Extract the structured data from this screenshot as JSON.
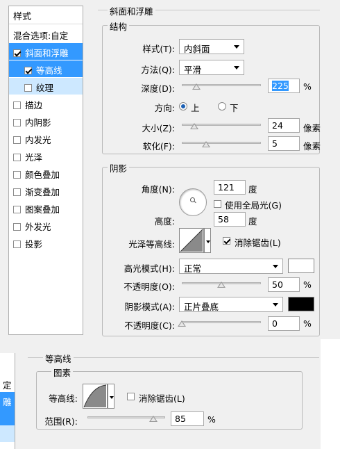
{
  "left_panel": {
    "header": "样式",
    "items": [
      {
        "label": "混合选项:自定",
        "checkbox": false
      },
      {
        "label": "斜面和浮雕",
        "checkbox": true,
        "checked": true,
        "selected": true
      },
      {
        "label": "等高线",
        "checkbox": true,
        "checked": true,
        "sub": true,
        "selected": true
      },
      {
        "label": "纹理",
        "checkbox": true,
        "checked": false,
        "sub": true
      },
      {
        "label": "描边",
        "checkbox": true,
        "checked": false
      },
      {
        "label": "内阴影",
        "checkbox": true,
        "checked": false
      },
      {
        "label": "内发光",
        "checkbox": true,
        "checked": false
      },
      {
        "label": "光泽",
        "checkbox": true,
        "checked": false
      },
      {
        "label": "颜色叠加",
        "checkbox": true,
        "checked": false
      },
      {
        "label": "渐变叠加",
        "checkbox": true,
        "checked": false
      },
      {
        "label": "图案叠加",
        "checkbox": true,
        "checked": false
      },
      {
        "label": "外发光",
        "checkbox": true,
        "checked": false
      },
      {
        "label": "投影",
        "checkbox": true,
        "checked": false
      }
    ]
  },
  "bevel": {
    "title": "斜面和浮雕",
    "structure": {
      "legend": "结构",
      "style_label": "样式(T):",
      "style_value": "内斜面",
      "technique_label": "方法(Q):",
      "technique_value": "平滑",
      "depth_label": "深度(D):",
      "depth_value": "225",
      "depth_unit": "%",
      "depth_level": 0.18,
      "direction_label": "方向:",
      "direction_up": "上",
      "direction_down": "下",
      "size_label": "大小(Z):",
      "size_value": "24",
      "size_unit": "像素",
      "size_level": 0.16,
      "soften_label": "软化(F):",
      "soften_value": "5",
      "soften_unit": "像素",
      "soften_level": 0.31
    },
    "shading": {
      "legend": "阴影",
      "angle_label": "角度(N):",
      "angle_value": "121",
      "angle_unit": "度",
      "global_light_label": "使用全局光(G)",
      "altitude_label": "高度:",
      "altitude_value": "58",
      "altitude_unit": "度",
      "gloss_label": "光泽等高线:",
      "antialias_label": "消除锯齿(L)",
      "highlight_label": "高光模式(H):",
      "highlight_value": "正常",
      "highlight_color": "#ffffff",
      "highlight_opacity_label": "不透明度(O):",
      "highlight_opacity_value": "50",
      "highlight_opacity_unit": "%",
      "highlight_opacity_level": 0.5,
      "shadow_label": "阴影模式(A):",
      "shadow_value": "正片叠底",
      "shadow_color": "#000000",
      "shadow_opacity_label": "不透明度(C):",
      "shadow_opacity_value": "0",
      "shadow_opacity_unit": "%",
      "shadow_opacity_level": 0.0
    }
  },
  "bottom": {
    "left_fragments": [
      "定",
      "雕"
    ],
    "title": "等高线",
    "legend": "图素",
    "contour_label": "等高线:",
    "antialias_label": "消除锯齿(L)",
    "range_label": "范围(R):",
    "range_value": "85",
    "range_unit": "%",
    "range_level": 0.85
  }
}
